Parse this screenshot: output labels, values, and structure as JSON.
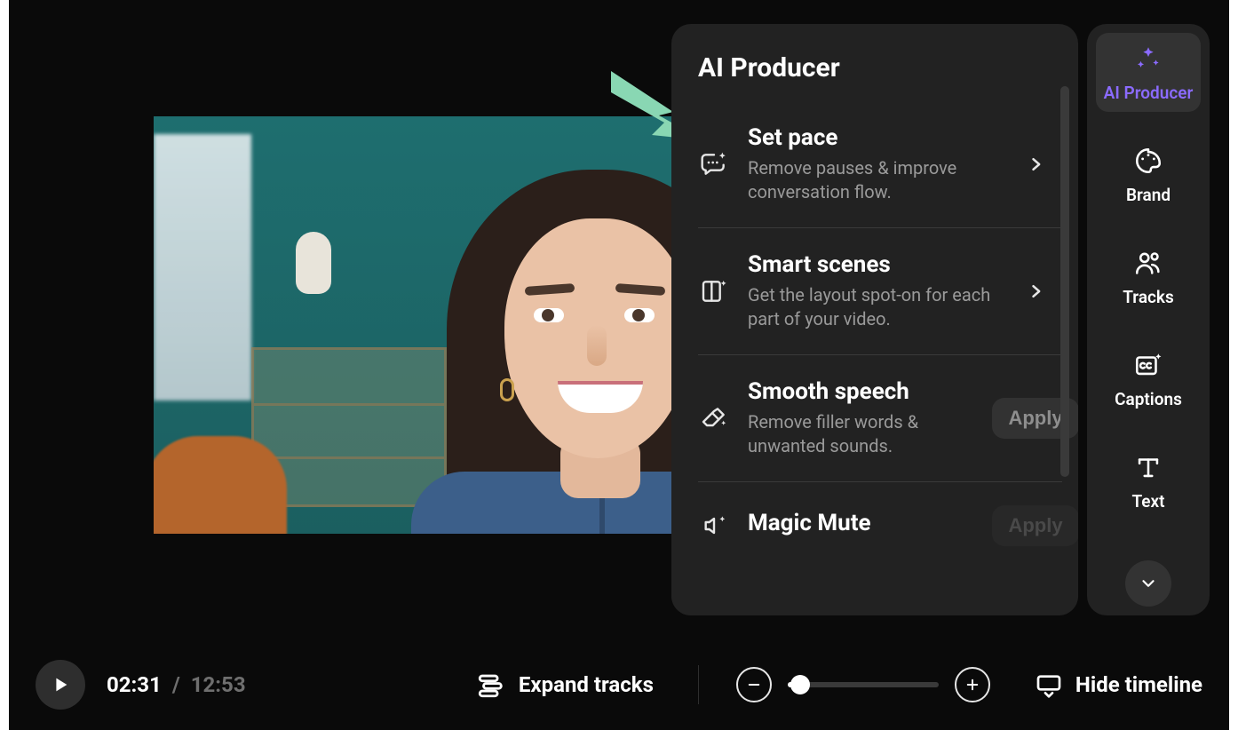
{
  "panel": {
    "title": "AI Producer",
    "items": [
      {
        "id": "set-pace",
        "title": "Set pace",
        "desc": "Remove pauses & improve conversation flow.",
        "action": "chevron"
      },
      {
        "id": "smart-scenes",
        "title": "Smart scenes",
        "desc": "Get the layout spot-on for each part of your video.",
        "action": "chevron"
      },
      {
        "id": "smooth-speech",
        "title": "Smooth speech",
        "desc": "Remove filler words & unwanted sounds.",
        "action": "apply",
        "apply_label": "Apply"
      },
      {
        "id": "magic-mute",
        "title": "Magic Mute",
        "desc": "",
        "action": "apply",
        "apply_label": "Apply"
      }
    ]
  },
  "sidebar": {
    "items": [
      {
        "id": "ai-producer",
        "label": "AI Producer",
        "active": true
      },
      {
        "id": "brand",
        "label": "Brand",
        "active": false
      },
      {
        "id": "tracks",
        "label": "Tracks",
        "active": false
      },
      {
        "id": "captions",
        "label": "Captions",
        "active": false
      },
      {
        "id": "text",
        "label": "Text",
        "active": false
      }
    ]
  },
  "player": {
    "current_time": "02:31",
    "separator": "/",
    "total_time": "12:53",
    "expand_label": "Expand tracks",
    "hide_label": "Hide timeline",
    "zoom_value": 0.06
  },
  "colors": {
    "accent": "#8b6bff",
    "pointer": "#89d7b3",
    "panel_bg": "#222222"
  }
}
